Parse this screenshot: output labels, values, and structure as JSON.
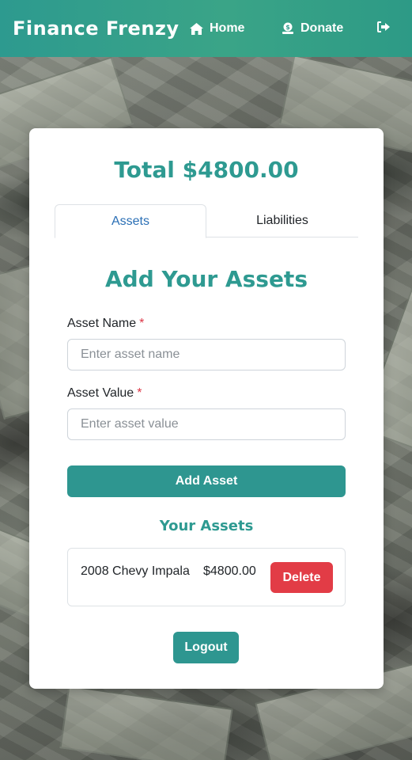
{
  "header": {
    "brand": "Finance Frenzy",
    "nav": {
      "home_label": "Home",
      "donate_label": "Donate"
    },
    "icons": [
      "home-icon",
      "donate-icon",
      "logout-icon"
    ],
    "gradient_colors": [
      "#2d9a8f",
      "#3aa487"
    ]
  },
  "summary": {
    "total_label": "Total $4800.00"
  },
  "tabs": [
    {
      "label": "Assets",
      "active": true
    },
    {
      "label": "Liabilities",
      "active": false
    }
  ],
  "form": {
    "title": "Add Your Assets",
    "name_label": "Asset Name",
    "name_placeholder": "Enter asset name",
    "value_label": "Asset Value",
    "value_placeholder": "Enter asset value",
    "required_marker": "*",
    "submit_label": "Add Asset"
  },
  "assets": {
    "title": "Your Assets",
    "items": [
      {
        "name": "2008 Chevy Impala",
        "value": "$4800.00",
        "delete_label": "Delete"
      }
    ]
  },
  "footer": {
    "logout_label": "Logout"
  },
  "colors": {
    "accent": "#2e9a91",
    "button": "#2e9690",
    "danger": "#e23c46",
    "active_tab": "#2a6fb5"
  }
}
